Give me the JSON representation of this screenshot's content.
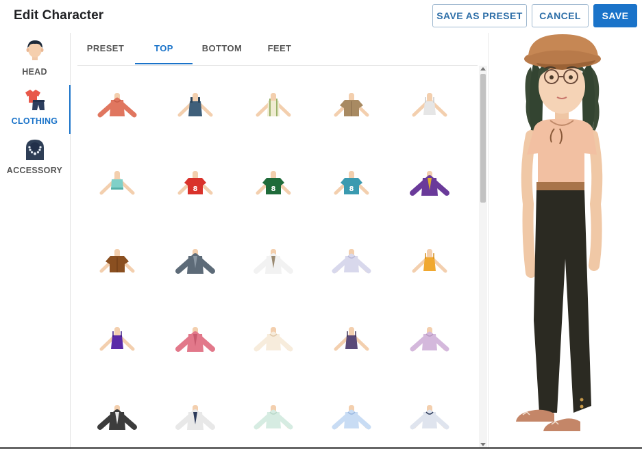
{
  "header": {
    "title": "Edit Character",
    "save_as_preset_label": "SAVE AS PRESET",
    "cancel_label": "CANCEL",
    "save_label": "SAVE"
  },
  "sidebar": {
    "items": [
      {
        "label": "HEAD",
        "icon": "head-icon",
        "active": false
      },
      {
        "label": "CLOTHING",
        "icon": "clothing-icon",
        "active": true
      },
      {
        "label": "ACCESSORY",
        "icon": "necklace-icon",
        "active": false
      }
    ]
  },
  "tabs": [
    {
      "label": "PRESET",
      "active": false
    },
    {
      "label": "TOP",
      "active": true
    },
    {
      "label": "BOTTOM",
      "active": false
    },
    {
      "label": "FEET",
      "active": false
    }
  ],
  "colors": {
    "accent": "#1a73c9",
    "skin": "#f3cfae"
  },
  "clothing_items": [
    {
      "name": "coral-sweater",
      "style": "long",
      "color": "#e0765f",
      "accent": "#c95d48"
    },
    {
      "name": "denim-overall-top",
      "style": "overall",
      "color": "#3f5f7a",
      "accent": "#2c455a"
    },
    {
      "name": "cream-suspender-top",
      "style": "suspender",
      "color": "#f0ecd2",
      "accent": "#9bb36b"
    },
    {
      "name": "khaki-shirt",
      "style": "short",
      "color": "#a88a62",
      "accent": "#86694a"
    },
    {
      "name": "white-tank",
      "style": "tank",
      "color": "#e6e6e6",
      "accent": "#c8c8c8"
    },
    {
      "name": "teal-crop-tank",
      "style": "crop",
      "color": "#7fd0c8",
      "accent": "#55b0a8"
    },
    {
      "name": "red-jersey-8",
      "style": "jersey",
      "color": "#d9322b",
      "accent": "#ffffff"
    },
    {
      "name": "green-jersey-8",
      "style": "jersey",
      "color": "#1f6b3a",
      "accent": "#ffffff"
    },
    {
      "name": "teal-striped-jersey",
      "style": "jersey",
      "color": "#3a9ab0",
      "accent": "#ffffff"
    },
    {
      "name": "purple-jacket",
      "style": "jacket",
      "color": "#6a3a9a",
      "accent": "#e0b030"
    },
    {
      "name": "brown-tee",
      "style": "short",
      "color": "#8a4f20",
      "accent": "#6a3a14"
    },
    {
      "name": "grey-cardigan",
      "style": "jacket",
      "color": "#5d6b78",
      "accent": "#8a97a3"
    },
    {
      "name": "white-cardigan-vest",
      "style": "jacket",
      "color": "#f2f2f2",
      "accent": "#9a8a72"
    },
    {
      "name": "lavender-plaid-shirt",
      "style": "long",
      "color": "#d8d8ec",
      "accent": "#b8b8d8"
    },
    {
      "name": "orange-cami",
      "style": "tank",
      "color": "#f0a830",
      "accent": "#d48c18"
    },
    {
      "name": "purple-halter",
      "style": "tank",
      "color": "#5a2aa8",
      "accent": "#3e1a84"
    },
    {
      "name": "pink-cardigan",
      "style": "jacket",
      "color": "#e2788a",
      "accent": "#c85a6e"
    },
    {
      "name": "cream-blouse",
      "style": "long",
      "color": "#f7ecdc",
      "accent": "#e0c8a8"
    },
    {
      "name": "plum-tank",
      "style": "tank",
      "color": "#5a4a78",
      "accent": "#3e3258"
    },
    {
      "name": "lilac-wrap-top",
      "style": "long",
      "color": "#d4b8dc",
      "accent": "#b89ac2"
    },
    {
      "name": "charcoal-blazer",
      "style": "jacket",
      "color": "#3c3c3c",
      "accent": "#e8e8e8"
    },
    {
      "name": "grey-suit-jacket",
      "style": "jacket",
      "color": "#e8e8e8",
      "accent": "#2c3a5a"
    },
    {
      "name": "mint-blouse",
      "style": "long",
      "color": "#d6ece2",
      "accent": "#b8d8c8"
    },
    {
      "name": "light-blue-shirt",
      "style": "long",
      "color": "#c8dcf4",
      "accent": "#9ab8e0"
    },
    {
      "name": "navy-vest-shirt",
      "style": "long",
      "color": "#dfe4ee",
      "accent": "#2c3a5a"
    }
  ]
}
